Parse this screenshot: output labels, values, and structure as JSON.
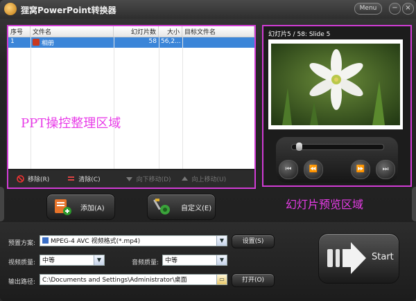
{
  "app": {
    "title": "狸窝PowerPoint转换器",
    "menu_label": "Menu",
    "minimize": "−",
    "close": "×"
  },
  "file_list": {
    "columns": {
      "index": "序号",
      "name": "文件名",
      "slides": "幻灯片数",
      "size": "大小",
      "target": "目标文件名"
    },
    "rows": [
      {
        "index": "1",
        "name": "相册",
        "slides": "58",
        "size": "56,2...",
        "target": ""
      }
    ],
    "area_label": "PPT操控整理区域"
  },
  "list_toolbar": {
    "remove": "移除(R)",
    "clear": "清除(C)",
    "move_down": "向下移动(D)",
    "move_up": "向上移动(U)"
  },
  "actions": {
    "add": "添加(A)",
    "customize": "自定义(E)"
  },
  "preview": {
    "caption": "幻灯片5 / 58: Slide 5",
    "area_label": "幻灯片预览区域",
    "progress": 0.05
  },
  "output": {
    "preset_label": "预置方案:",
    "preset_value": "MPEG-4 AVC 视频格式(*.mp4)",
    "settings_button": "设置(S)",
    "video_quality_label": "视频质量:",
    "video_quality_value": "中等",
    "audio_quality_label": "音频质量:",
    "audio_quality_value": "中等",
    "path_label": "输出路径:",
    "path_value": "C:\\Documents and Settings\\Administrator\\桌面",
    "open_button": "打开(O)",
    "start_button": "Start"
  },
  "colors": {
    "highlight": "#d23cd6",
    "selection": "#3b85d8",
    "annotation": "#e83ce8"
  }
}
